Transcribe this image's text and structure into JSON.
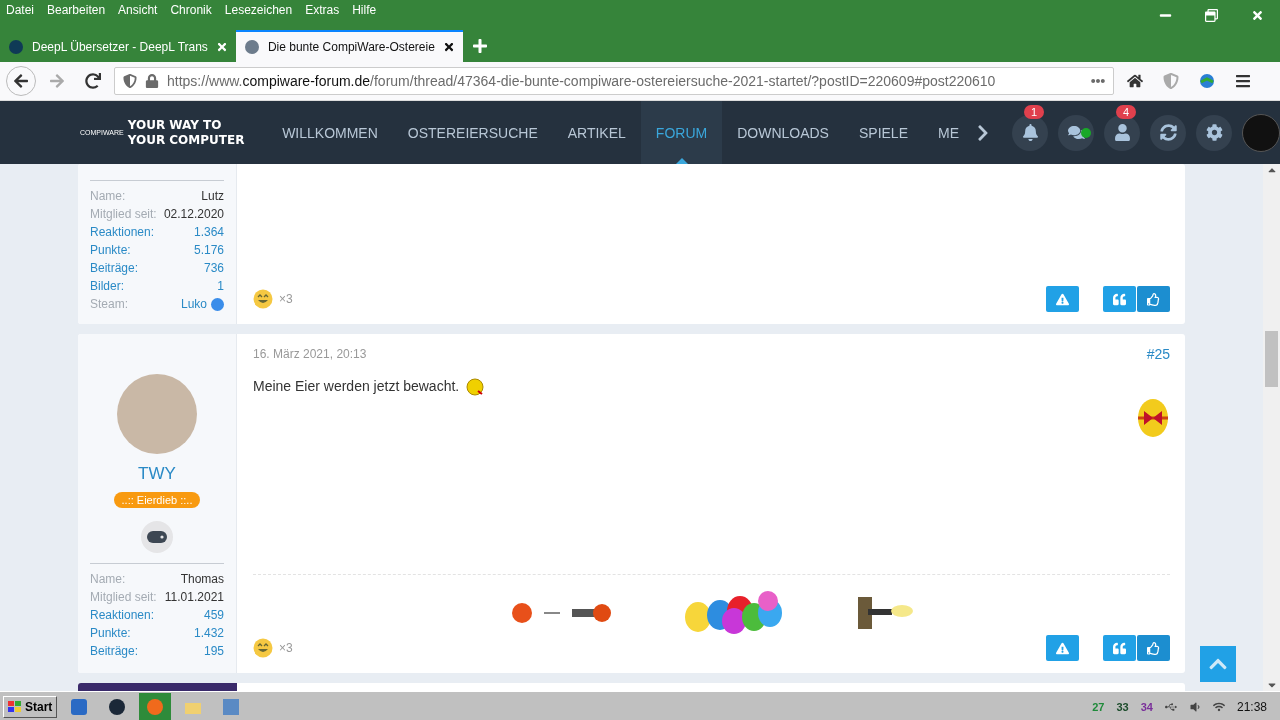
{
  "menu": [
    "Datei",
    "Bearbeiten",
    "Ansicht",
    "Chronik",
    "Lesezeichen",
    "Extras",
    "Hilfe"
  ],
  "tabs": [
    {
      "title": "DeepL Übersetzer - DeepL Trans",
      "selected": false
    },
    {
      "title": "Die bunte CompiWare-Ostereie",
      "selected": true
    }
  ],
  "url": {
    "prefix": "https://www.",
    "domain": "compiware-forum.de",
    "path": "/forum/thread/47364-die-bunte-compiware-ostereiersuche-2021-startet/?postID=220609#post220610"
  },
  "site": {
    "logo_small": "COMPIWARE",
    "logo_lines": [
      "YOUR WAY TO",
      "YOUR COMPUTER"
    ],
    "nav": [
      {
        "label": "WILLKOMMEN",
        "selected": false
      },
      {
        "label": "OSTEREIERSUCHE",
        "selected": false
      },
      {
        "label": "ARTIKEL",
        "selected": false
      },
      {
        "label": "FORUM",
        "selected": true
      },
      {
        "label": "DOWNLOADS",
        "selected": false
      },
      {
        "label": "SPIELE",
        "selected": false
      },
      {
        "label": "ME",
        "selected": false
      }
    ],
    "user_icons": [
      {
        "kind": "bell",
        "badge": "1",
        "online": false
      },
      {
        "kind": "chat",
        "online": true
      },
      {
        "kind": "user",
        "badge": "4",
        "online": false
      },
      {
        "kind": "refresh",
        "online": false
      },
      {
        "kind": "gear",
        "online": false
      }
    ]
  },
  "posts": [
    {
      "partial": true,
      "stats": [
        {
          "label": "Name:",
          "value": "Lutz",
          "linked": false
        },
        {
          "label": "Mitglied seit:",
          "value": "02.12.2020",
          "linked": false
        },
        {
          "label": "Reaktionen:",
          "value": "1.364",
          "linked": true
        },
        {
          "label": "Punkte:",
          "value": "5.176",
          "linked": true
        },
        {
          "label": "Beiträge:",
          "value": "736",
          "linked": true
        },
        {
          "label": "Bilder:",
          "value": "1",
          "linked": true
        },
        {
          "label": "Steam:",
          "value": "Luko",
          "linked": false,
          "steam": true
        }
      ],
      "reaction_count": "×3"
    },
    {
      "partial": false,
      "username": "TWY",
      "rank": "..:: Eierdieb ::..",
      "date": "16. März 2021, 20:13",
      "number": "#25",
      "text": "Meine Eier werden jetzt bewacht.",
      "stats": [
        {
          "label": "Name:",
          "value": "Thomas",
          "linked": false
        },
        {
          "label": "Mitglied seit:",
          "value": "11.01.2021",
          "linked": false
        },
        {
          "label": "Reaktionen:",
          "value": "459",
          "linked": true
        },
        {
          "label": "Punkte:",
          "value": "1.432",
          "linked": true
        },
        {
          "label": "Beiträge:",
          "value": "195",
          "linked": true
        }
      ],
      "reaction_count": "×3"
    }
  ],
  "taskbar": {
    "start": "Start",
    "tray": [
      {
        "text": "27",
        "color": "#1f8a3a"
      },
      {
        "text": "33",
        "color": "#1d4d2c"
      },
      {
        "text": "34",
        "color": "#7a2f9a"
      }
    ],
    "time": "21:38"
  }
}
